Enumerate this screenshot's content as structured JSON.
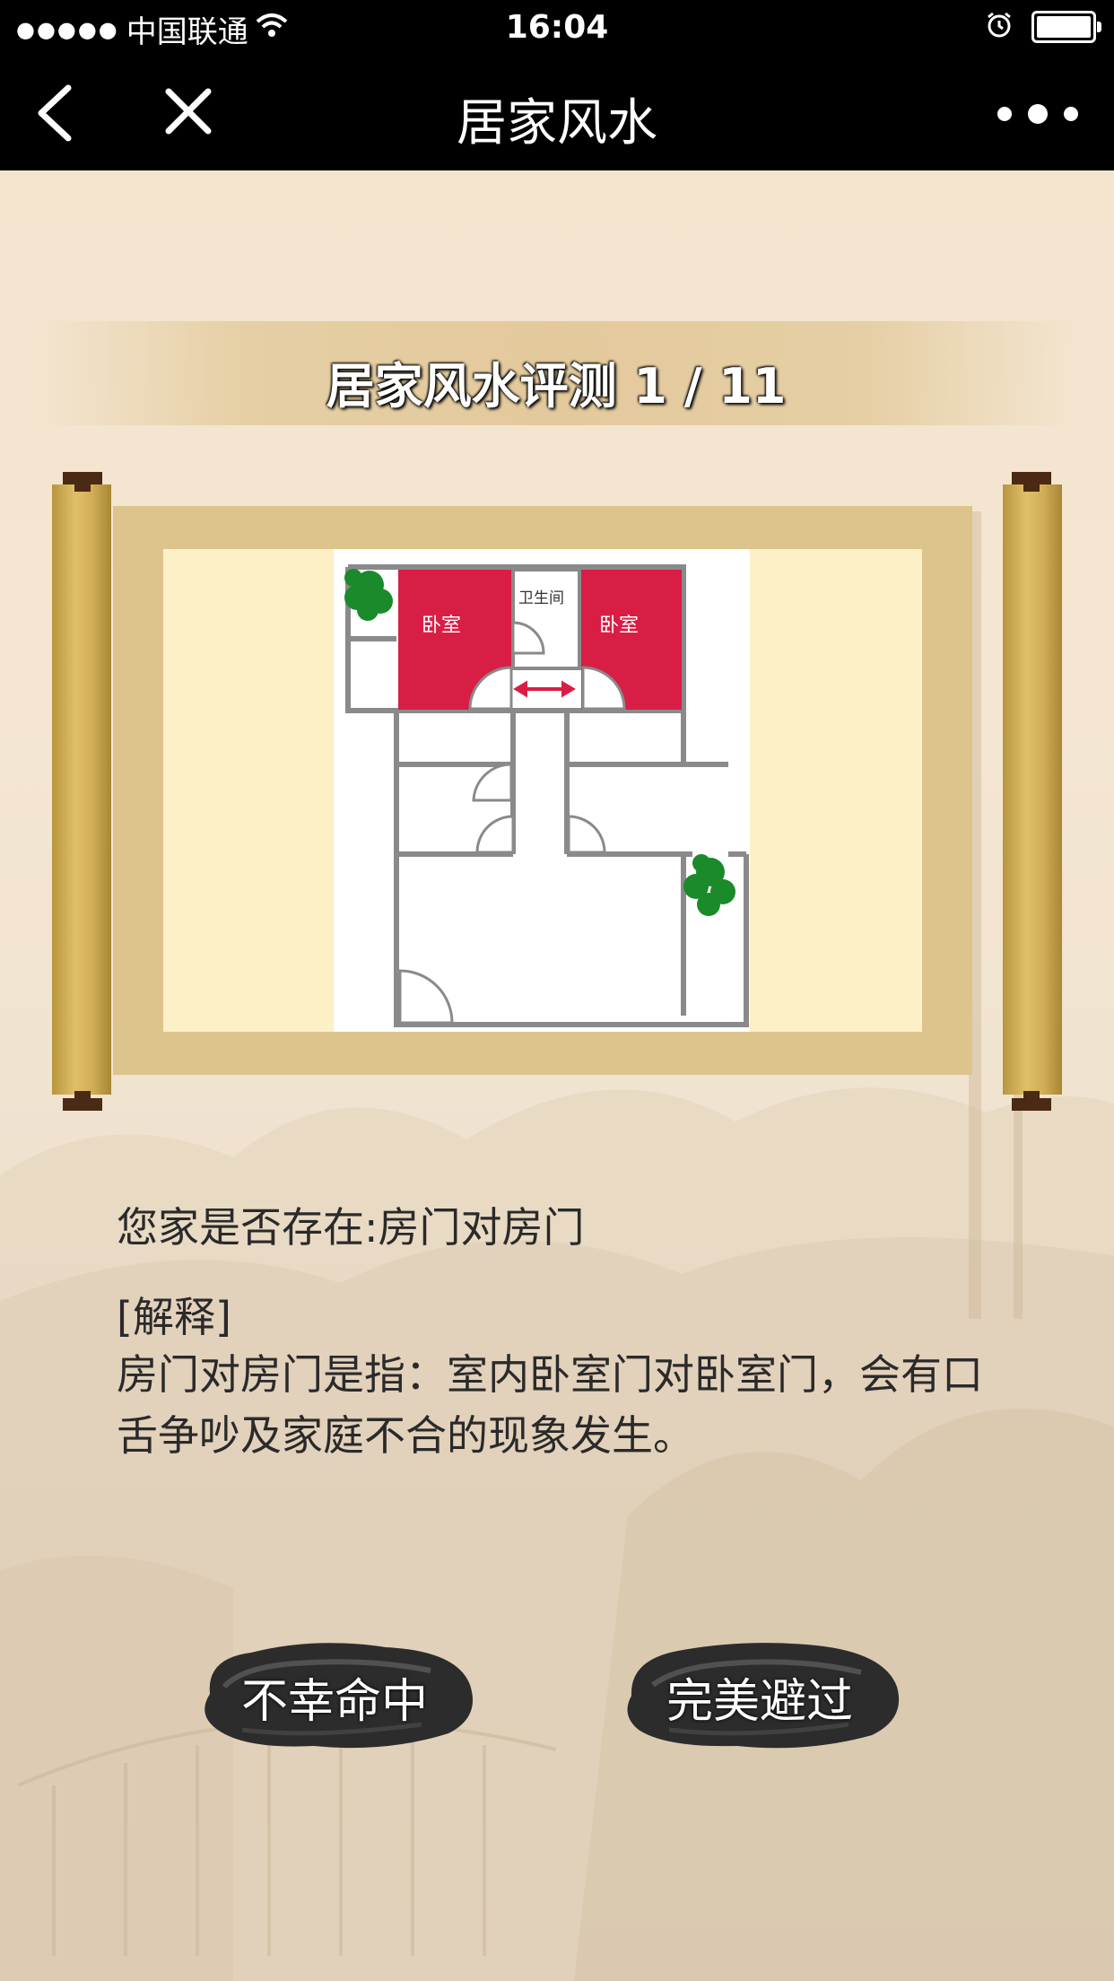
{
  "status_bar": {
    "signal": "●●●●●",
    "carrier": "中国联通",
    "time": "16:04",
    "icons": [
      "wifi-icon",
      "alarm-icon",
      "battery-icon"
    ]
  },
  "nav": {
    "title": "居家风水",
    "icons": [
      "back-icon",
      "close-icon",
      "more-icon"
    ]
  },
  "quiz": {
    "title": "居家风水评测 1 / 11",
    "floorplan": {
      "rooms": [
        "卧室",
        "卫生间",
        "卧室"
      ]
    },
    "question": "您家是否存在:房门对房门",
    "explain_label": "[解释]",
    "explain_text": "房门对房门是指：室内卧室门对卧室门，会有口舌争吵及家庭不合的现象发生。"
  },
  "buttons": {
    "hit": "不幸命中",
    "avoid": "完美避过"
  },
  "colors": {
    "bar": "#000000",
    "scroll_frame": "#dcc48c",
    "scroll_paper": "#fdefc6",
    "room_red": "#d81e45",
    "plant_green": "#1a8a2a"
  }
}
